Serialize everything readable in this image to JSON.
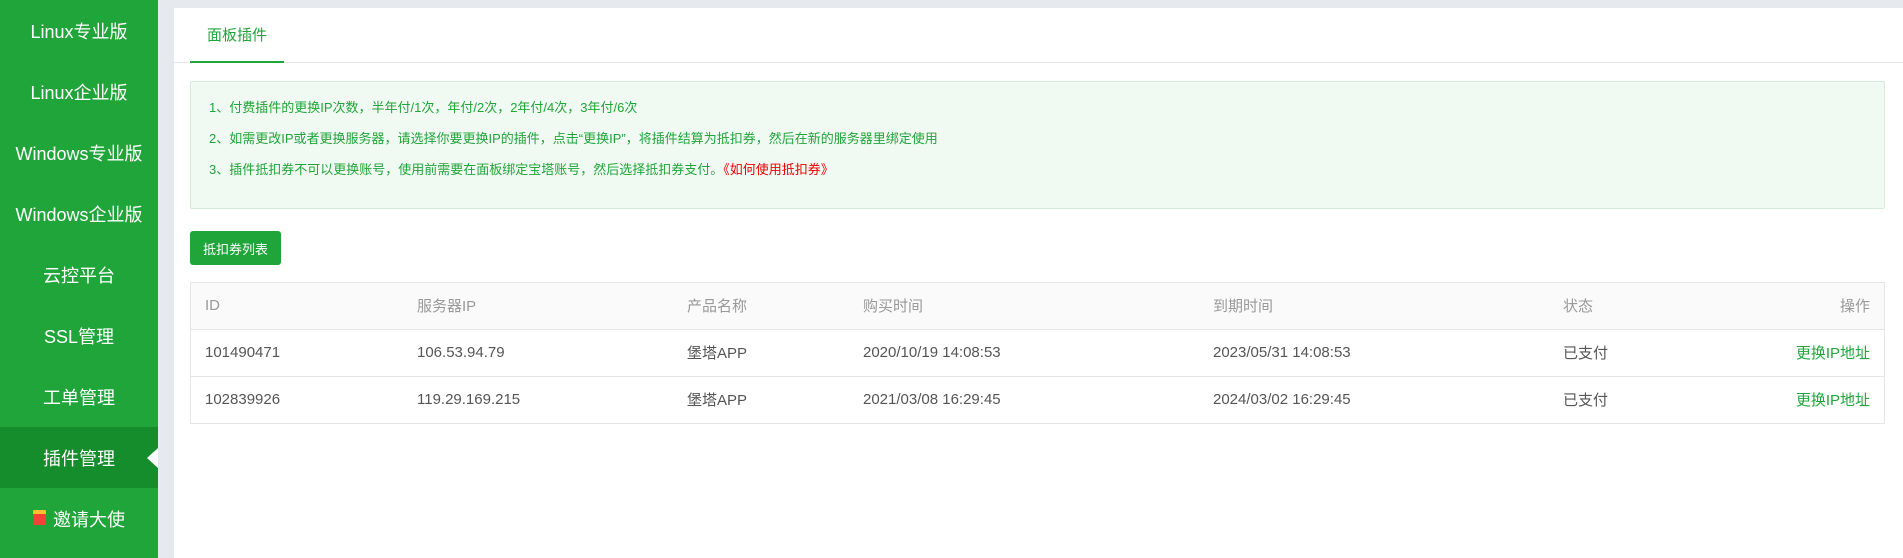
{
  "sidebar": {
    "items": [
      {
        "label": "Linux专业版"
      },
      {
        "label": "Linux企业版"
      },
      {
        "label": "Windows专业版"
      },
      {
        "label": "Windows企业版"
      },
      {
        "label": "云控平台"
      },
      {
        "label": "SSL管理"
      },
      {
        "label": "工单管理"
      },
      {
        "label": "插件管理"
      },
      {
        "label": "邀请大使"
      }
    ],
    "active_item": "插件管理"
  },
  "tabs": {
    "active_label": "面板插件"
  },
  "notice": {
    "line1": "1、付费插件的更换IP次数，半年付/1次，年付/2次，2年付/4次，3年付/6次",
    "line2": "2、如需更改IP或者更换服务器，请选择你要更换IP的插件，点击“更换IP”，将插件结算为抵扣券，然后在新的服务器里绑定使用",
    "line3": "3、插件抵扣券不可以更换账号，使用前需要在面板绑定宝塔账号，然后选择抵扣券支付。",
    "line3_link": "《如何使用抵扣券》"
  },
  "toolbar": {
    "voucher_list_label": "抵扣券列表"
  },
  "table": {
    "headers": {
      "id": "ID",
      "server_ip": "服务器IP",
      "product": "产品名称",
      "purchase_time": "购买时间",
      "expire_time": "到期时间",
      "status": "状态",
      "action": "操作"
    },
    "rows": [
      {
        "id": "101490471",
        "server_ip": "106.53.94.79",
        "product": "堡塔APP",
        "purchase_time": "2020/10/19 14:08:53",
        "expire_time": "2023/05/31 14:08:53",
        "status": "已支付",
        "action": "更换IP地址"
      },
      {
        "id": "102839926",
        "server_ip": "119.29.169.215",
        "product": "堡塔APP",
        "purchase_time": "2021/03/08 16:29:45",
        "expire_time": "2024/03/02 16:29:45",
        "status": "已支付",
        "action": "更换IP地址"
      }
    ]
  },
  "colors": {
    "brand_green": "#20a53a",
    "active_green": "#168d2c",
    "link_red": "#ee0000"
  },
  "icons": {
    "invite": "gift-icon"
  }
}
